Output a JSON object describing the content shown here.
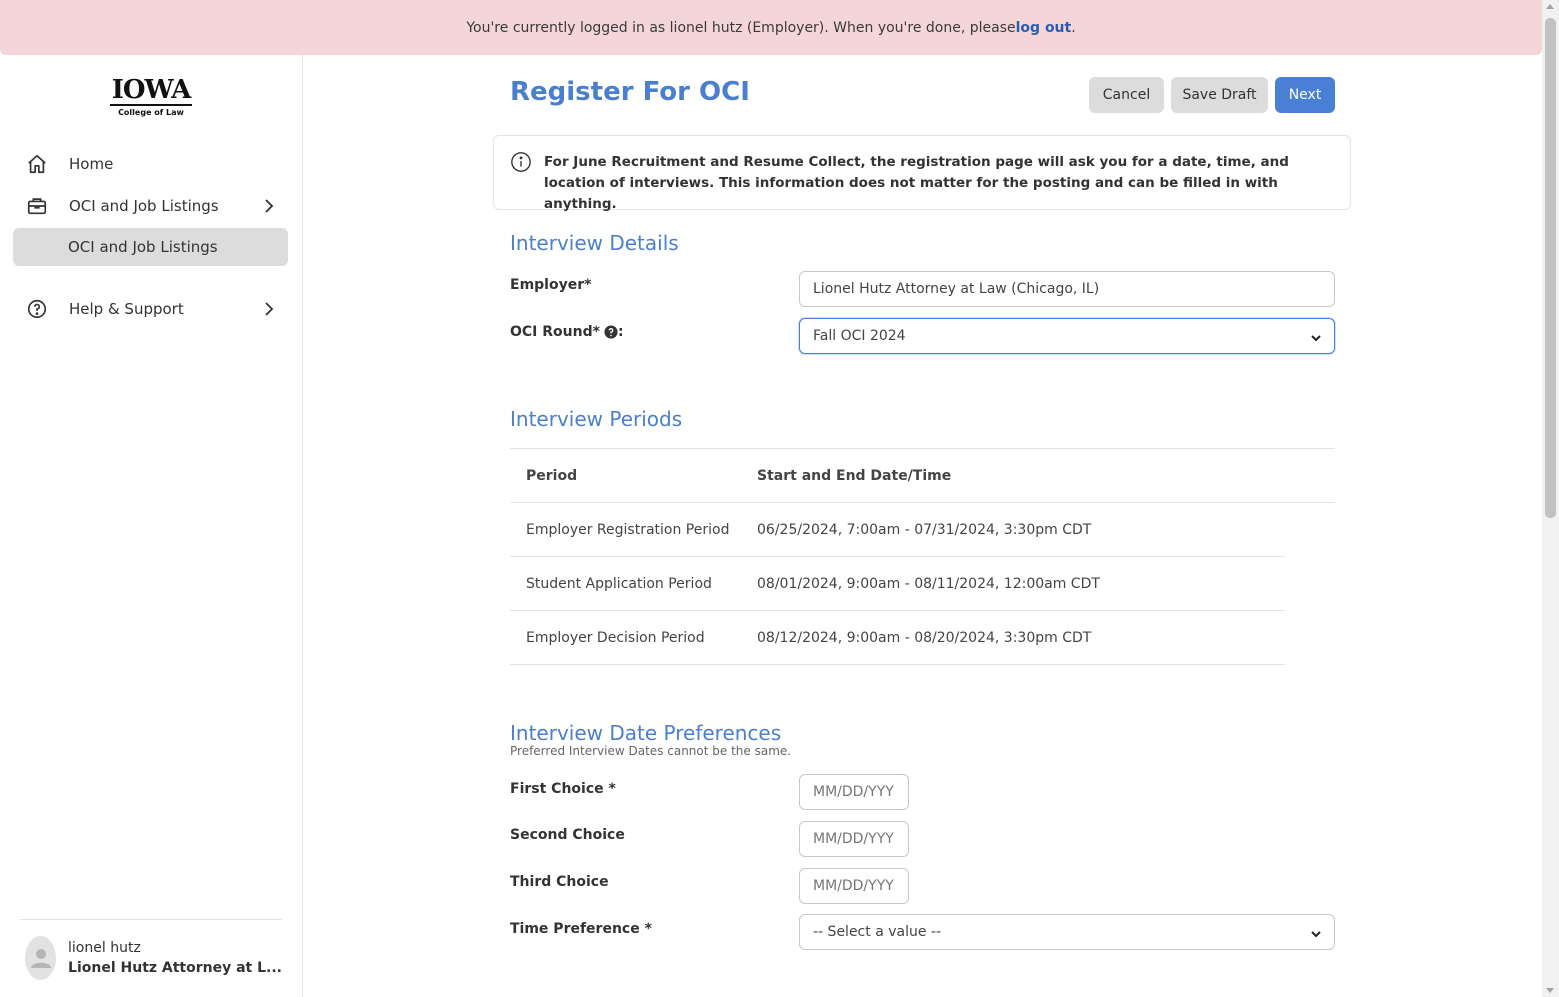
{
  "banner": {
    "text_prefix": "You're currently logged in as lionel hutz (Employer). When you're done, please ",
    "link": "log out",
    "text_suffix": "."
  },
  "logo": {
    "title": "IOWA",
    "subtitle": "College of Law"
  },
  "sidebar": {
    "items": [
      {
        "label": "Home",
        "icon": "home-icon"
      },
      {
        "label": "OCI and Job Listings",
        "icon": "briefcase-icon"
      },
      {
        "label": "OCI and Job Listings",
        "icon": ""
      },
      {
        "label": "Help & Support",
        "icon": "help-circle-icon"
      }
    ],
    "user": {
      "name": "lionel hutz",
      "org": "Lionel Hutz Attorney at L..."
    }
  },
  "header": {
    "title": "Register For OCI",
    "cancel_label": "Cancel",
    "save_draft_label": "Save Draft",
    "next_label": "Next"
  },
  "info": {
    "text": "For June Recruitment and Resume Collect, the registration page will ask you for a date, time, and location of interviews. This information does not matter for the posting and can be filled in with anything."
  },
  "interview_details": {
    "title": "Interview Details",
    "employer_label": "Employer*",
    "employer_value": "Lionel Hutz Attorney at Law (Chicago, IL)",
    "round_label": "OCI Round*",
    "round_suffix": ":",
    "round_value": "Fall OCI 2024"
  },
  "interview_periods": {
    "title": "Interview Periods",
    "columns": [
      "Period",
      "Start and End Date/Time"
    ],
    "rows": [
      [
        "Employer Registration Period",
        "06/25/2024, 7:00am - 07/31/2024, 3:30pm CDT"
      ],
      [
        "Student Application Period",
        "08/01/2024, 9:00am - 08/11/2024, 12:00am CDT"
      ],
      [
        "Employer Decision Period",
        "08/12/2024, 9:00am - 08/20/2024, 3:30pm CDT"
      ]
    ]
  },
  "date_preferences": {
    "title": "Interview Date Preferences",
    "note": "Preferred Interview Dates cannot be the same.",
    "first_label": "First Choice *",
    "second_label": "Second Choice",
    "third_label": "Third Choice",
    "date_placeholder": "MM/DD/YYY",
    "time_label": "Time Preference *",
    "time_value": "-- Select a value --"
  },
  "colors": {
    "accent": "#4a7fd0",
    "banner": "#f4d5d8",
    "button_blue": "#4a7fd6"
  }
}
